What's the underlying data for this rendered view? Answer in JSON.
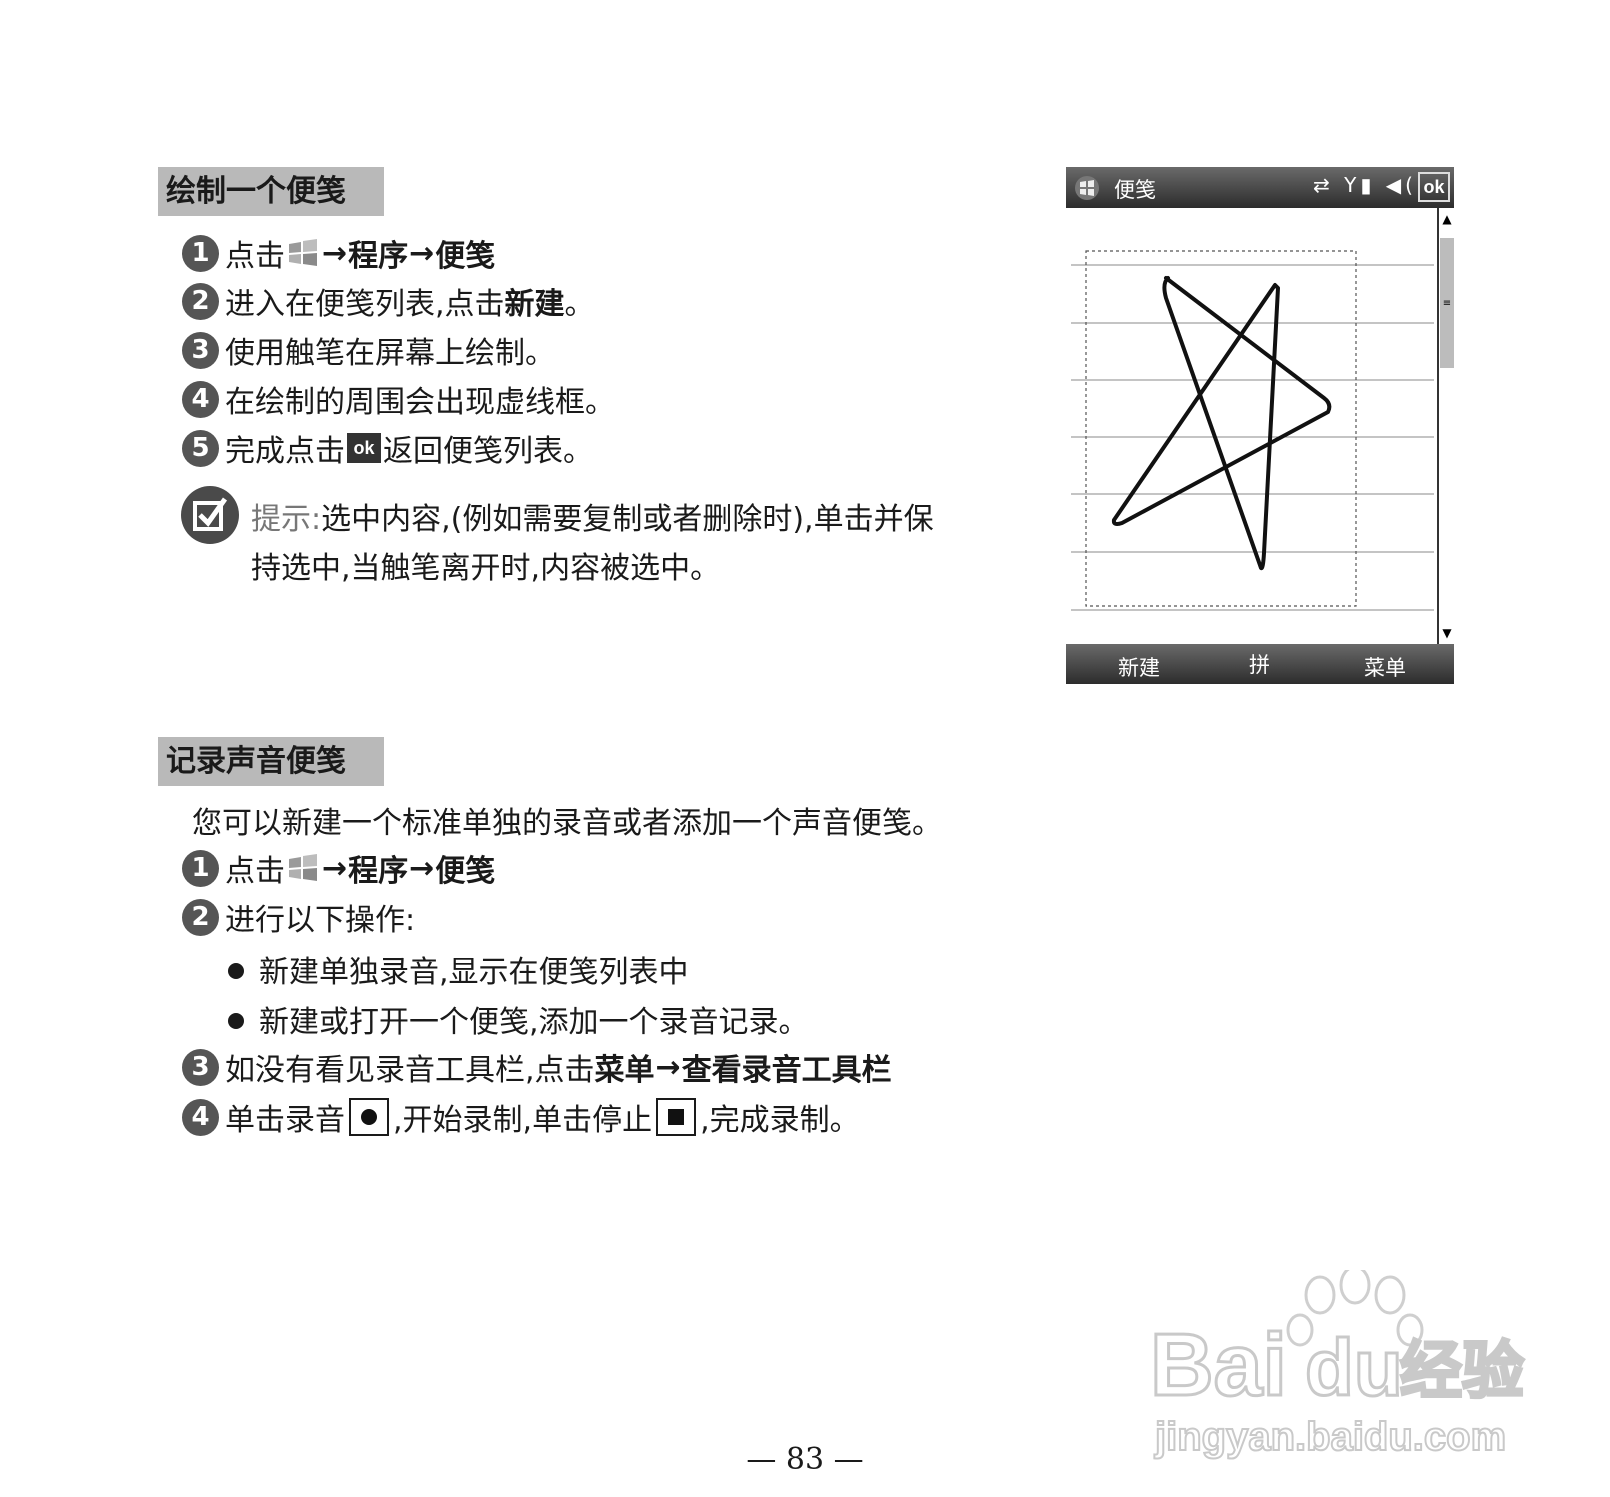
{
  "section1": {
    "heading": "绘制一个便笺",
    "steps": [
      {
        "num": "1",
        "pre": "点击",
        "parts": [
          "程序",
          "便笺"
        ]
      },
      {
        "num": "2",
        "pre": "进入在便笺列表,点击",
        "bold": "新建",
        "post": "。"
      },
      {
        "num": "3",
        "text": "使用触笔在屏幕上绘制。"
      },
      {
        "num": "4",
        "text": "在绘制的周围会出现虚线框。"
      },
      {
        "num": "5",
        "pre": "完成点击",
        "ok": "ok",
        "post": "返回便笺列表。"
      }
    ],
    "tip": {
      "label": "提示:",
      "line1": "选中内容,(例如需要复制或者删除时),单击并保",
      "line2": "持选中,当触笔离开时,内容被选中。"
    }
  },
  "device": {
    "title": "便笺",
    "status_icons": "⇄ Y▮ ◀(",
    "ok": "ok",
    "softkeys": {
      "left": "新建",
      "middle": "拼",
      "right": "菜单"
    }
  },
  "section2": {
    "heading": "记录声音便笺",
    "intro": "您可以新建一个标准单独的录音或者添加一个声音便笺。",
    "steps": [
      {
        "num": "1",
        "pre": "点击",
        "parts": [
          "程序",
          "便笺"
        ]
      },
      {
        "num": "2",
        "text": "进行以下操作:"
      },
      {
        "num": "3",
        "pre": "如没有看见录音工具栏,点击",
        "parts": [
          "菜单",
          "查看录音工具栏"
        ]
      },
      {
        "num": "4",
        "pre": "单击录音",
        "mid": ",开始录制,单击停止",
        "post": ",完成录制。"
      }
    ],
    "bullets": [
      "新建单独录音,显示在便笺列表中",
      "新建或打开一个便笺,添加一个录音记录。"
    ]
  },
  "arrow": "→",
  "page_number": "— 83 —",
  "watermark": {
    "brand": "Bai",
    "brand2": "du",
    "suffix": "经验",
    "url": "jingyan.baidu.com"
  }
}
